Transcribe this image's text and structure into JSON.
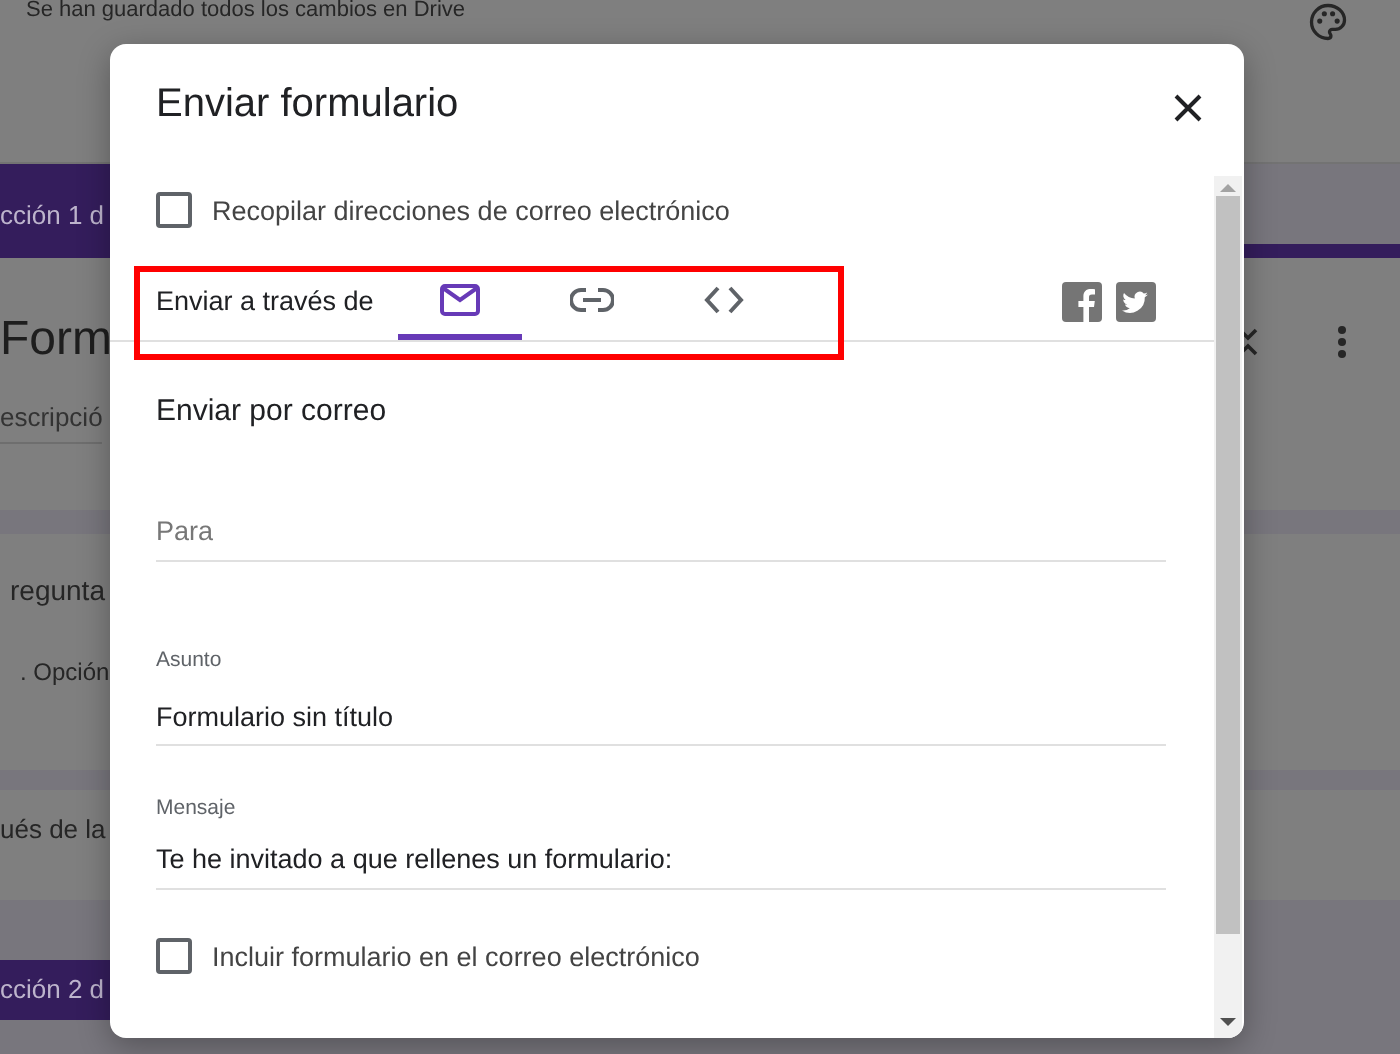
{
  "background": {
    "save_status": "Se han guardado todos los cambios en Drive",
    "section_1_tag": "cción 1 d",
    "form_title": "Form",
    "form_description": "escripció",
    "question": "regunta",
    "option": ". Opción",
    "after_section": "ués de la",
    "section_2_tag": "cción 2 d"
  },
  "dialog": {
    "title": "Enviar formulario",
    "collect_emails": {
      "label": "Recopilar direcciones de correo electrónico",
      "checked": false
    },
    "send_via": {
      "label": "Enviar a través de",
      "highlighted": true,
      "tabs": [
        {
          "kind": "email",
          "selected": true
        },
        {
          "kind": "link",
          "selected": false
        },
        {
          "kind": "embed",
          "selected": false
        }
      ],
      "share": [
        {
          "kind": "facebook"
        },
        {
          "kind": "twitter"
        }
      ]
    },
    "section_title": "Enviar por correo",
    "to": {
      "placeholder": "Para"
    },
    "subject": {
      "label": "Asunto",
      "value": "Formulario sin título"
    },
    "message": {
      "label": "Mensaje",
      "value": "Te he invitado a que rellenes un formulario:"
    },
    "include_form": {
      "label": "Incluir formulario en el correo electrónico",
      "checked": false
    }
  }
}
